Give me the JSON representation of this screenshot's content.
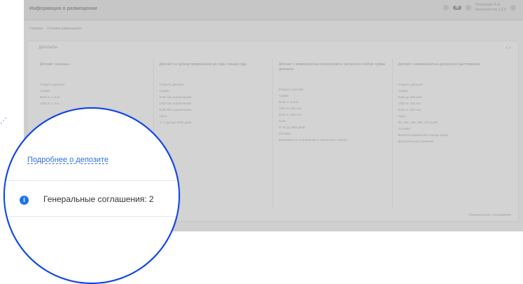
{
  "header": {
    "title": "Информация о размещении",
    "badge": "25",
    "user_line1": "Петрушкин Е.А.",
    "user_line2": "Казначейство 3.1.0"
  },
  "breadcrumbs": [
    "Главная",
    "Условия размещения"
  ],
  "panel": {
    "title": "Депозиты",
    "arrows": "‹  ›",
    "footer": "Генеральные соглашения"
  },
  "columns": [
    {
      "title": "Депозит «знаешь»",
      "lines": [
        "Открыть депозит",
        "Сумма",
        "RUB от 1 млн",
        "USD от 1 тыс"
      ]
    },
    {
      "title": "Депозит со сроком привлечения до года / свыше года",
      "lines": [
        "Открыть депозит",
        "Сумма",
        "RUB без ограничений",
        "USD без ограничений",
        "EUR без ограничений",
        "Срок",
        "от 1 дня до 1000 дней"
      ]
    },
    {
      "title": "Депозит с возможностью пополнения и частичного снятия суммы депозита",
      "lines": [
        "Открыть депозит",
        "Сумма",
        "RUB от 3 млн",
        "USD от 100 тыс",
        "EUR от 100 тыс",
        "Срок",
        "от 31 до 364 дней",
        "Условия",
        "Возможность пополнения и частичного снятия"
      ]
    },
    {
      "title": "Депозит с возможностью досрочного расторжения",
      "lines": [
        "Открыть депозит",
        "Сумма",
        "RUB до 400 млн",
        "USD от 100 тыс",
        "EUR от 100 тыс",
        "Срок",
        "90, 180, 182, 365, 370 дней",
        "Условия",
        "Выплата процентов в конце срока",
        "Досрочное расторжение"
      ]
    }
  ],
  "magnifier": {
    "link": "Подробнее о депозите",
    "info_icon": "i",
    "info_text": "Генеральные соглашения: 2"
  },
  "arrow_glyph": "⋰"
}
